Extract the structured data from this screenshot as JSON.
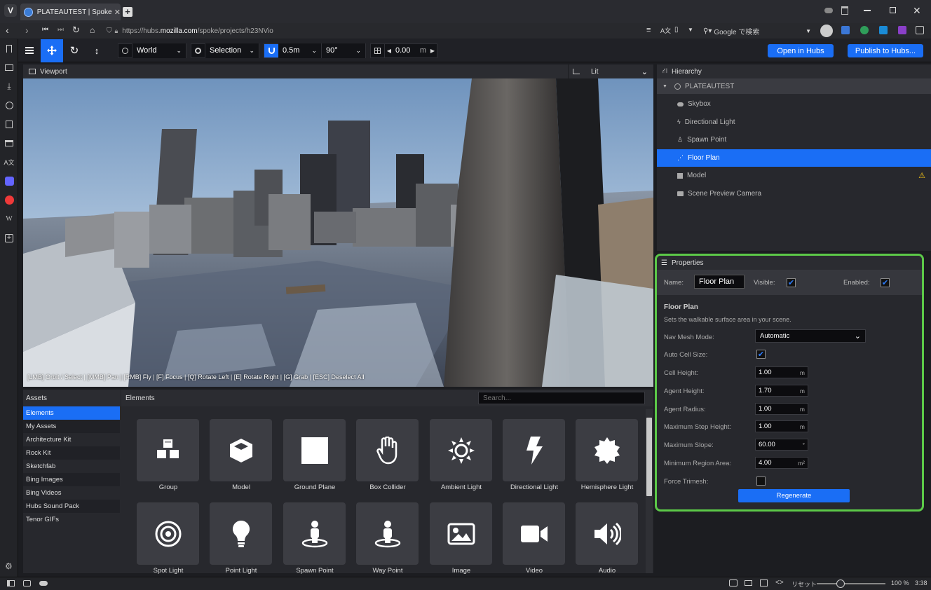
{
  "browser": {
    "tab_title": "PLATEAUTEST | Spoke by M",
    "url_prefix": "https://hubs.",
    "url_host": "mozilla.com",
    "url_path": "/spoke/projects/h23NVio",
    "search_placeholder": "Google で検索",
    "status_reset": "リセット",
    "zoom": "100 %",
    "time": "3:38",
    "zoom_level": 0.35
  },
  "toolbar": {
    "space": "World",
    "pivot": "Selection",
    "snap_translate": "0.5m",
    "snap_rotate": "90°",
    "grid_value": "0.00",
    "grid_unit": "m",
    "open_hubs": "Open in Hubs",
    "publish": "Publish to Hubs..."
  },
  "viewport": {
    "title": "Viewport",
    "render_mode": "Lit",
    "hint": "[LMB] Orbit / Select | [MMB] Pan | [RMB] Fly | [F] Focus | [Q] Rotate Left | [E] Rotate Right | [G] Grab | [ESC] Deselect All"
  },
  "hierarchy": {
    "title": "Hierarchy",
    "root": "PLATEAUTEST",
    "items": [
      {
        "label": "Skybox",
        "icon": "cloud-icon"
      },
      {
        "label": "Directional Light",
        "icon": "bolt-icon"
      },
      {
        "label": "Spawn Point",
        "icon": "person-icon"
      },
      {
        "label": "Floor Plan",
        "icon": "shoe-prints-icon",
        "selected": true
      },
      {
        "label": "Model",
        "icon": "cube-icon",
        "warning": true
      },
      {
        "label": "Scene Preview Camera",
        "icon": "camera-icon"
      }
    ]
  },
  "properties": {
    "title": "Properties",
    "name_label": "Name:",
    "name_value": "Floor Plan",
    "visible_label": "Visible:",
    "enabled_label": "Enabled:",
    "section_title": "Floor Plan",
    "section_desc": "Sets the walkable surface area in your scene.",
    "nav_mesh_label": "Nav Mesh Mode:",
    "nav_mesh_value": "Automatic",
    "auto_cell_label": "Auto Cell Size:",
    "fields": [
      {
        "label": "Cell Height:",
        "value": "1.00",
        "unit": "m"
      },
      {
        "label": "Agent Height:",
        "value": "1.70",
        "unit": "m"
      },
      {
        "label": "Agent Radius:",
        "value": "1.00",
        "unit": "m"
      },
      {
        "label": "Maximum Step Height:",
        "value": "1.00",
        "unit": "m"
      },
      {
        "label": "Maximum Slope:",
        "value": "60.00",
        "unit": "°"
      },
      {
        "label": "Minimum Region Area:",
        "value": "4.00",
        "unit": "m²"
      }
    ],
    "force_trimesh_label": "Force Trimesh:",
    "regenerate": "Regenerate"
  },
  "assets": {
    "title": "Assets",
    "elements_title": "Elements",
    "search_placeholder": "Search...",
    "sources": [
      "Elements",
      "My Assets",
      "Architecture Kit",
      "Rock Kit",
      "Sketchfab",
      "Bing Images",
      "Bing Videos",
      "Hubs Sound Pack",
      "Tenor GIFs"
    ],
    "elements": [
      {
        "label": "Group",
        "icon": "cubes-icon"
      },
      {
        "label": "Model",
        "icon": "cube-icon"
      },
      {
        "label": "Ground Plane",
        "icon": "square-icon"
      },
      {
        "label": "Box Collider",
        "icon": "hand-icon"
      },
      {
        "label": "Ambient Light",
        "icon": "sun-icon"
      },
      {
        "label": "Directional Light",
        "icon": "bolt-icon"
      },
      {
        "label": "Hemisphere Light",
        "icon": "certificate-icon"
      },
      {
        "label": "Spot Light",
        "icon": "bullseye-icon"
      },
      {
        "label": "Point Light",
        "icon": "lightbulb-icon"
      },
      {
        "label": "Spawn Point",
        "icon": "street-view-icon"
      },
      {
        "label": "Way Point",
        "icon": "street-view-icon"
      },
      {
        "label": "Image",
        "icon": "image-icon"
      },
      {
        "label": "Video",
        "icon": "video-icon"
      },
      {
        "label": "Audio",
        "icon": "volume-icon"
      }
    ]
  }
}
